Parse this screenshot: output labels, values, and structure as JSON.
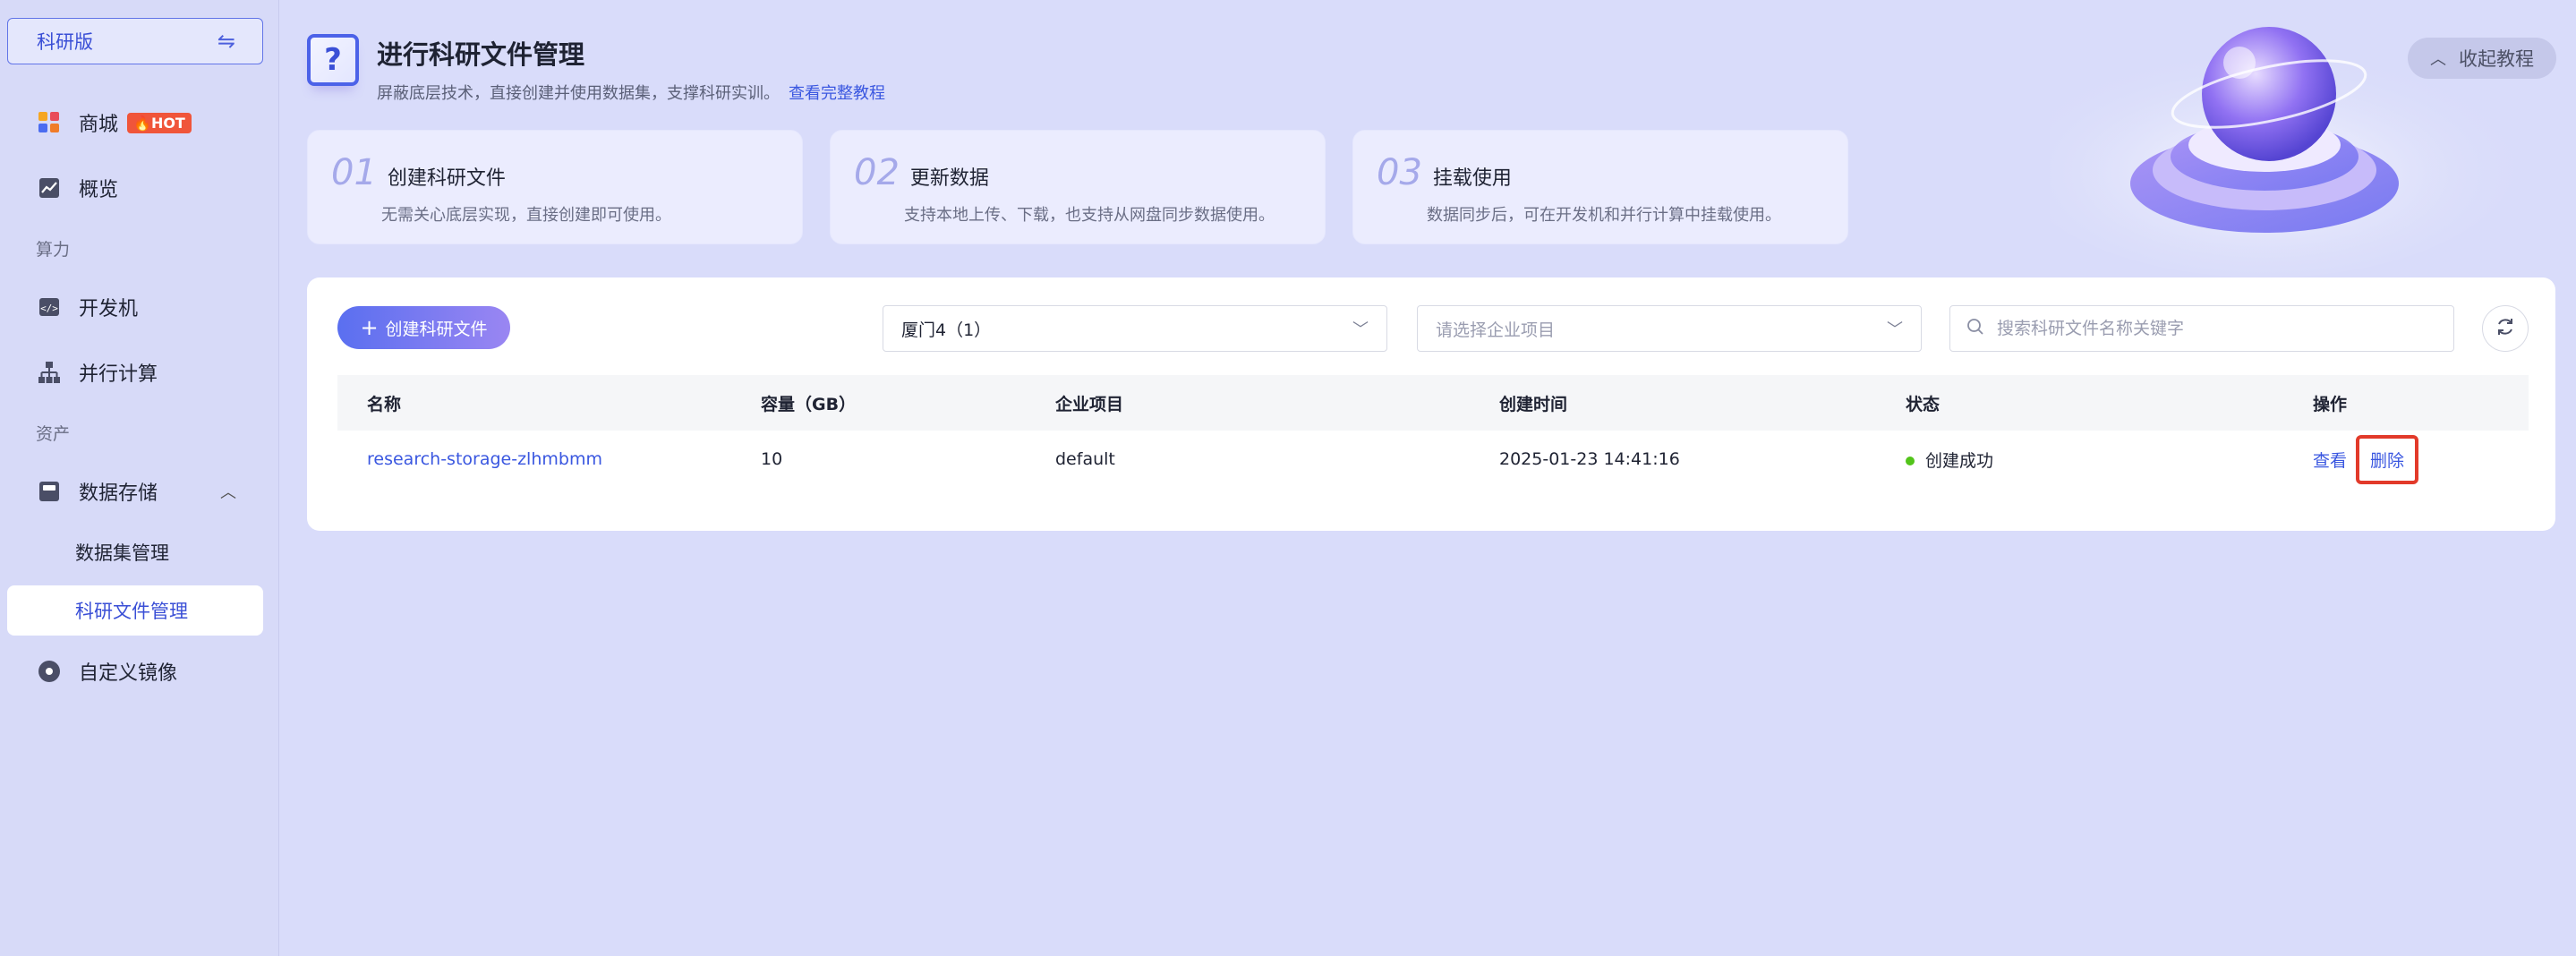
{
  "sidebar": {
    "version_label": "科研版",
    "swap_icon": "swap-icon",
    "items": {
      "store": {
        "label": "商城",
        "badge": "HOT"
      },
      "overview": {
        "label": "概览"
      },
      "section_compute": "算力",
      "devbox": {
        "label": "开发机"
      },
      "parallel": {
        "label": "并行计算"
      },
      "section_assets": "资产",
      "storage": {
        "label": "数据存储"
      },
      "dataset_mgmt": {
        "label": "数据集管理"
      },
      "research_file_mgmt": {
        "label": "科研文件管理"
      },
      "custom_image": {
        "label": "自定义镜像"
      }
    }
  },
  "hero": {
    "title": "进行科研文件管理",
    "subtitle": "屏蔽底层技术，直接创建并使用数据集，支撑科研实训。",
    "tutorial_link": "查看完整教程",
    "collapse_label": "收起教程"
  },
  "steps": [
    {
      "num": "01",
      "title": "创建科研文件",
      "desc": "无需关心底层实现，直接创建即可使用。"
    },
    {
      "num": "02",
      "title": "更新数据",
      "desc": "支持本地上传、下载，也支持从网盘同步数据使用。"
    },
    {
      "num": "03",
      "title": "挂载使用",
      "desc": "数据同步后，可在开发机和并行计算中挂载使用。"
    }
  ],
  "toolbar": {
    "create_label": "创建科研文件",
    "region_value": "厦门4（1）",
    "project_placeholder": "请选择企业项目",
    "search_placeholder": "搜索科研文件名称关键字"
  },
  "table": {
    "headers": [
      "名称",
      "容量（GB）",
      "企业项目",
      "创建时间",
      "状态",
      "操作"
    ],
    "rows": [
      {
        "name": "research-storage-zlhmbmm",
        "capacity": "10",
        "project": "default",
        "created": "2025-01-23 14:41:16",
        "status": "创建成功",
        "op_view": "查看",
        "op_delete": "删除"
      }
    ]
  },
  "colors": {
    "accent": "#3a57e0",
    "status_ok": "#52c41a",
    "highlight": "#e23a2a",
    "hot": "#f0553a"
  }
}
